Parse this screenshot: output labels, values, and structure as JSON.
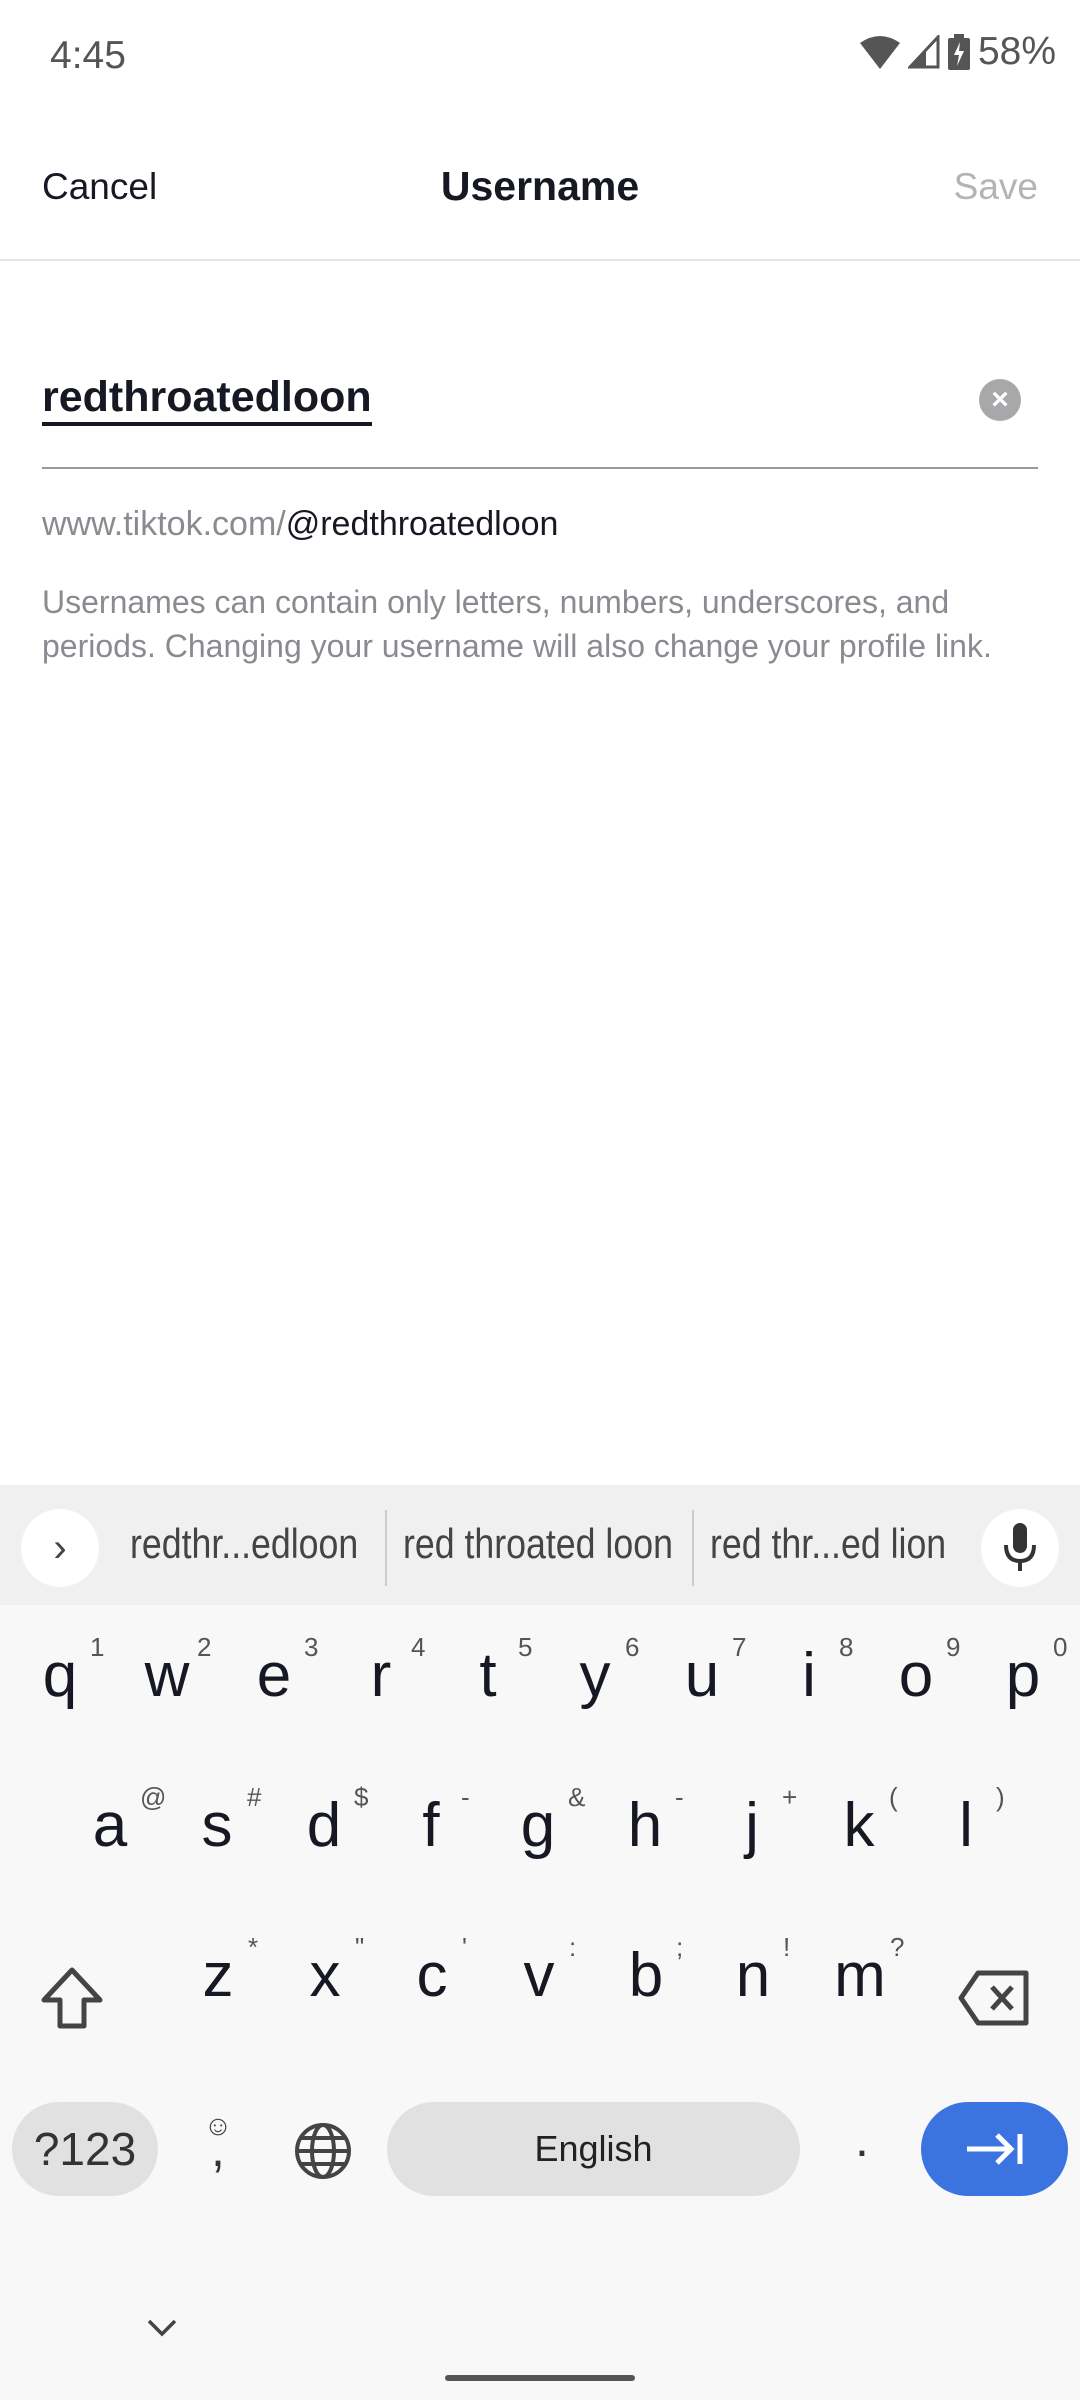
{
  "status": {
    "time": "4:45",
    "battery": "58%",
    "icons": [
      "wifi-icon",
      "signal-icon",
      "battery-charging-icon"
    ]
  },
  "header": {
    "cancel": "Cancel",
    "title": "Username",
    "save": "Save"
  },
  "form": {
    "username": "redthroatedloon",
    "url_prefix": "www.tiktok.com/",
    "url_handle": "@redthroatedloon",
    "help": "Usernames can contain only letters, numbers, underscores, and periods. Changing your username will also change your profile link."
  },
  "keyboard": {
    "suggestions": [
      "redthr...edloon",
      "red throated loon",
      "red thr...ed lion"
    ],
    "row1": [
      [
        "q",
        "1"
      ],
      [
        "w",
        "2"
      ],
      [
        "e",
        "3"
      ],
      [
        "r",
        "4"
      ],
      [
        "t",
        "5"
      ],
      [
        "y",
        "6"
      ],
      [
        "u",
        "7"
      ],
      [
        "i",
        "8"
      ],
      [
        "o",
        "9"
      ],
      [
        "p",
        "0"
      ]
    ],
    "row2": [
      [
        "a",
        "@"
      ],
      [
        "s",
        "#"
      ],
      [
        "d",
        "$"
      ],
      [
        "f",
        "-"
      ],
      [
        "g",
        "&"
      ],
      [
        "h",
        "-"
      ],
      [
        "j",
        "+"
      ],
      [
        "k",
        "("
      ],
      [
        "l",
        ")"
      ]
    ],
    "row3": [
      [
        "z",
        "*"
      ],
      [
        "x",
        "\""
      ],
      [
        "c",
        "'"
      ],
      [
        "v",
        ":"
      ],
      [
        "b",
        ";"
      ],
      [
        "n",
        "!"
      ],
      [
        "m",
        "?"
      ]
    ],
    "symbols": "?123",
    "comma": ",",
    "space": "English",
    "period": ".",
    "accent": "#3b73e0"
  }
}
